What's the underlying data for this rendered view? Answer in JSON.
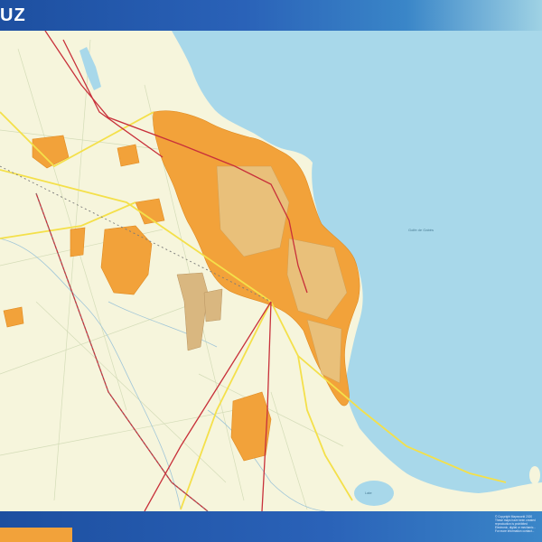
{
  "header": {
    "title": "UZ"
  },
  "map": {
    "sea_label": "Golfe de Gabès",
    "lake_label": "Lake",
    "colors": {
      "land": "#f6f5dc",
      "sea": "#a8d8ea",
      "urban": "#f2a23a",
      "urban_dark": "#e08a20",
      "major_road": "#c8303a",
      "road_yellow": "#f4e04a",
      "grid_line": "#c9d6b0",
      "river": "#9fc5d8"
    }
  },
  "footer": {
    "copyright_lines": [
      "© Copyright Mapsworld 2020",
      "These maps have been created",
      "reproduction is prohibited",
      "Electronic, digital or mechanic...",
      "For more information contact..."
    ]
  }
}
